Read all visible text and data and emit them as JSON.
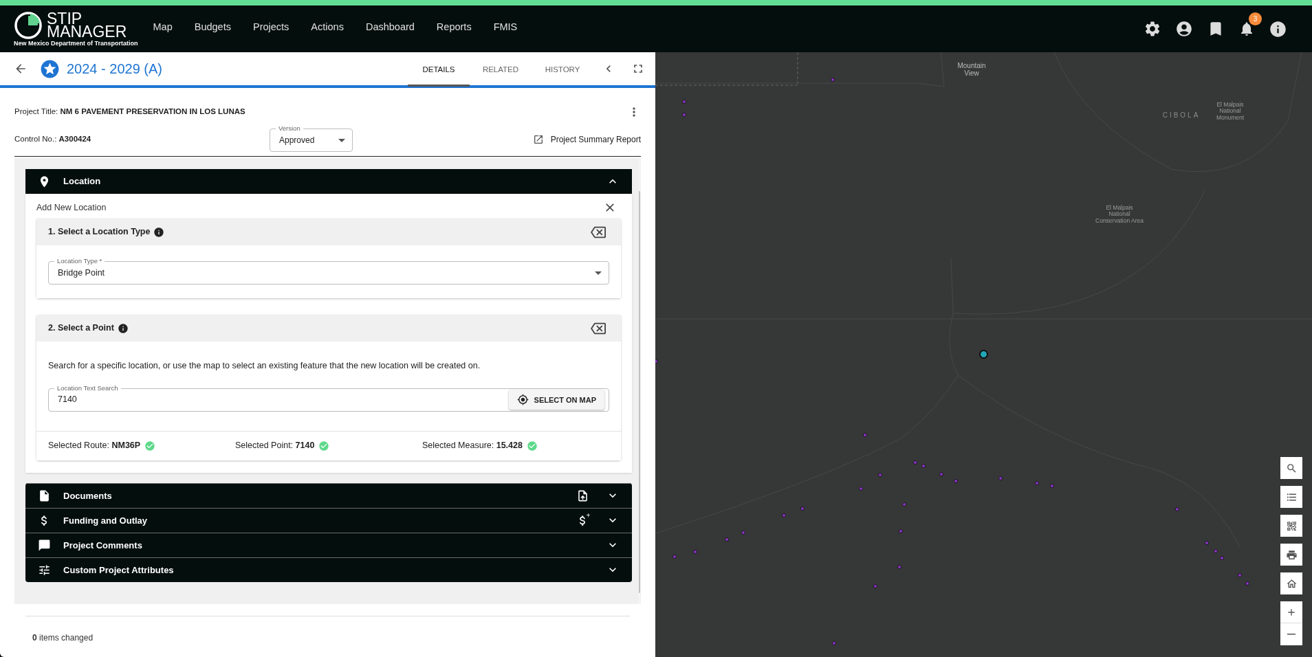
{
  "header": {
    "logo_line_1": "STIP",
    "logo_line_2": "MANAGER",
    "logo_subtitle": "New Mexico Department of Transportation",
    "nav": [
      {
        "label": "Map"
      },
      {
        "label": "Budgets"
      },
      {
        "label": "Projects"
      },
      {
        "label": "Actions"
      },
      {
        "label": "Dashboard"
      },
      {
        "label": "Reports"
      },
      {
        "label": "FMIS"
      }
    ],
    "notification_count": "3"
  },
  "project_bar": {
    "title": "2024 - 2029 (A)",
    "tabs": [
      {
        "label": "DETAILS",
        "selected": true
      },
      {
        "label": "RELATED",
        "selected": false
      },
      {
        "label": "HISTORY",
        "selected": false
      }
    ]
  },
  "project": {
    "title_label": "Project Title:",
    "title_value": "NM 6 PAVEMENT PRESERVATION IN LOS LUNAS",
    "control_label": "Control No.:",
    "control_value": "A300424",
    "version": {
      "label": "Version",
      "value": "Approved"
    },
    "report_link": "Project Summary Report"
  },
  "sections": [
    {
      "kind": "location",
      "title": "Location",
      "expanded": true
    },
    {
      "kind": "documents",
      "title": "Documents",
      "expanded": false
    },
    {
      "kind": "funding",
      "title": "Funding and Outlay",
      "expanded": false
    },
    {
      "kind": "comments",
      "title": "Project Comments",
      "expanded": false
    },
    {
      "kind": "attributes",
      "title": "Custom Project Attributes",
      "expanded": false
    }
  ],
  "location_form": {
    "heading": "Add New Location",
    "step_1": {
      "title": "1. Select a Location Type",
      "field_label": "Location Type *",
      "field_value": "Bridge Point"
    },
    "step_2": {
      "title": "2. Select a Point",
      "hint": "Search for a specific location, or use the map to select an existing feature that the new location will be created on.",
      "field_label": "Location Text Search",
      "field_value": "7140",
      "button": "SELECT ON MAP",
      "results": [
        {
          "label": "Selected Route:",
          "value": "NM36P"
        },
        {
          "label": "Selected Point:",
          "value": "7140"
        },
        {
          "label": "Selected Measure:",
          "value": "15.428"
        }
      ]
    }
  },
  "footer": {
    "count": "0",
    "text": "items changed"
  },
  "map": {
    "labels": [
      {
        "kind": "place",
        "text": "Mountain View"
      },
      {
        "kind": "region",
        "text": "CIBOLA"
      },
      {
        "kind": "park",
        "text": "El Malpais National Monument"
      },
      {
        "kind": "park",
        "text": "El Malpais National Conservation Area"
      }
    ]
  }
}
